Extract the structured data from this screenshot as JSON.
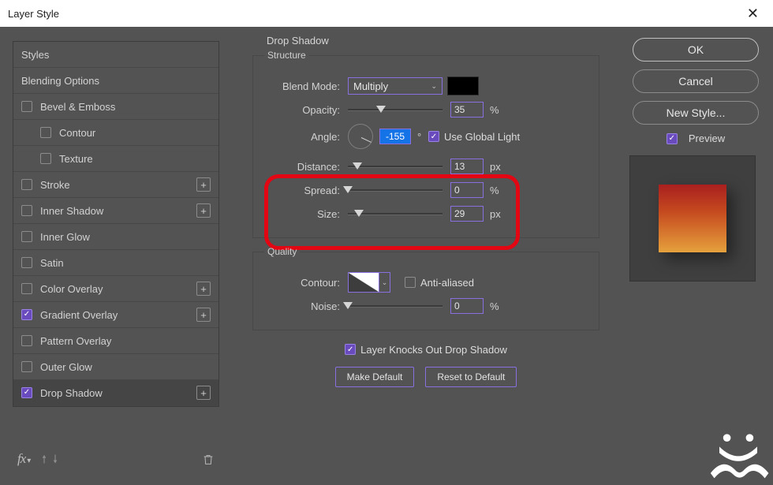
{
  "window": {
    "title": "Layer Style"
  },
  "styles_list": {
    "header": "Styles",
    "blending": "Blending Options",
    "items": [
      {
        "label": "Bevel & Emboss",
        "checked": false,
        "add": false,
        "sub": false
      },
      {
        "label": "Contour",
        "checked": false,
        "add": false,
        "sub": true
      },
      {
        "label": "Texture",
        "checked": false,
        "add": false,
        "sub": true
      },
      {
        "label": "Stroke",
        "checked": false,
        "add": true,
        "sub": false
      },
      {
        "label": "Inner Shadow",
        "checked": false,
        "add": true,
        "sub": false
      },
      {
        "label": "Inner Glow",
        "checked": false,
        "add": false,
        "sub": false
      },
      {
        "label": "Satin",
        "checked": false,
        "add": false,
        "sub": false
      },
      {
        "label": "Color Overlay",
        "checked": false,
        "add": true,
        "sub": false
      },
      {
        "label": "Gradient Overlay",
        "checked": true,
        "add": true,
        "sub": false
      },
      {
        "label": "Pattern Overlay",
        "checked": false,
        "add": false,
        "sub": false
      },
      {
        "label": "Outer Glow",
        "checked": false,
        "add": false,
        "sub": false
      },
      {
        "label": "Drop Shadow",
        "checked": true,
        "add": true,
        "sub": false,
        "selected": true
      }
    ],
    "fx_label": "fx"
  },
  "center": {
    "title": "Drop Shadow",
    "structure_legend": "Structure",
    "quality_legend": "Quality",
    "blend_mode_label": "Blend Mode:",
    "blend_mode_value": "Multiply",
    "opacity_label": "Opacity:",
    "opacity_value": "35",
    "opacity_unit": "%",
    "angle_label": "Angle:",
    "angle_value": "-155",
    "angle_unit": "°",
    "global_light_label": "Use Global Light",
    "global_light_checked": true,
    "distance_label": "Distance:",
    "distance_value": "13",
    "distance_unit": "px",
    "spread_label": "Spread:",
    "spread_value": "0",
    "spread_unit": "%",
    "size_label": "Size:",
    "size_value": "29",
    "size_unit": "px",
    "contour_label": "Contour:",
    "antialiased_label": "Anti-aliased",
    "antialiased_checked": false,
    "noise_label": "Noise:",
    "noise_value": "0",
    "noise_unit": "%",
    "knocks_out_label": "Layer Knocks Out Drop Shadow",
    "knocks_out_checked": true,
    "make_default": "Make Default",
    "reset_default": "Reset to Default"
  },
  "right": {
    "ok": "OK",
    "cancel": "Cancel",
    "new_style": "New Style...",
    "preview_label": "Preview",
    "preview_checked": true
  }
}
